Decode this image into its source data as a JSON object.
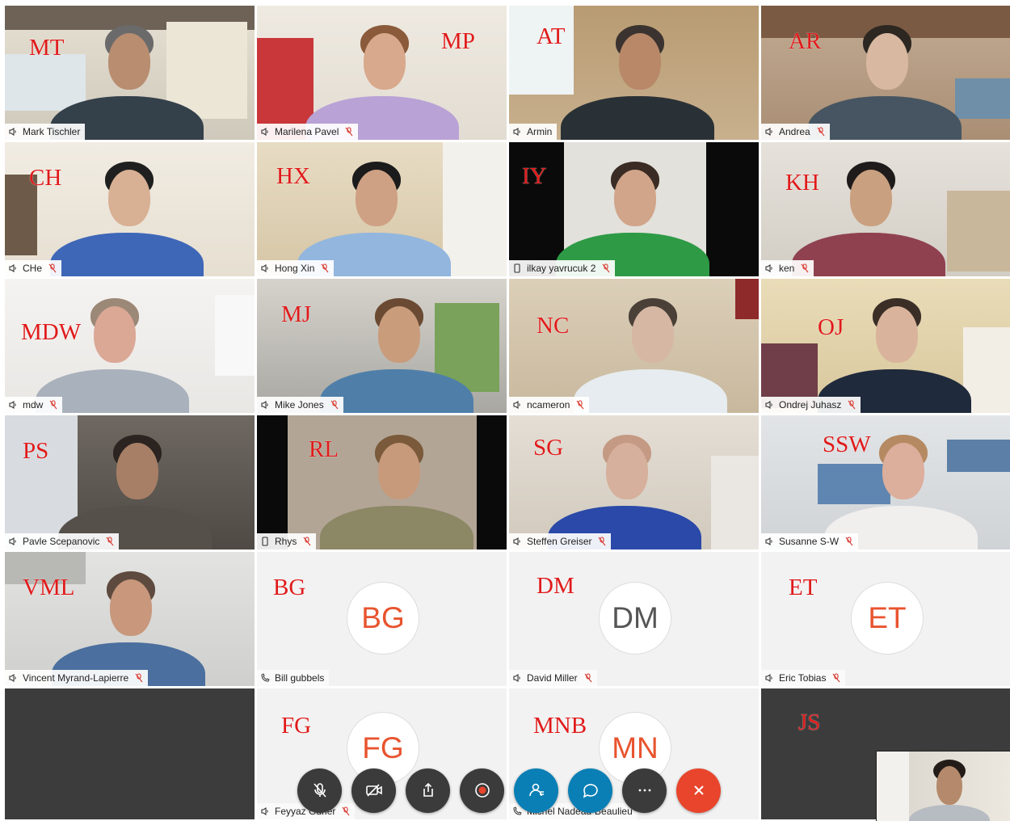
{
  "participants": [
    {
      "initials": "MT",
      "name": "Mark Tischler",
      "icon": "speaker-icon",
      "muted": false,
      "active": true
    },
    {
      "initials": "MP",
      "name": "Marilena Pavel",
      "icon": "speaker-icon",
      "muted": true,
      "active": false
    },
    {
      "initials": "AT",
      "name": "Armin",
      "icon": "speaker-icon",
      "muted": false,
      "active": true
    },
    {
      "initials": "AR",
      "name": "Andrea",
      "icon": "speaker-icon",
      "muted": true,
      "active": false
    },
    {
      "initials": "CH",
      "name": "CHe",
      "icon": "speaker-icon",
      "muted": true,
      "active": false
    },
    {
      "initials": "HX",
      "name": "Hong Xin",
      "icon": "speaker-icon",
      "muted": true,
      "active": false
    },
    {
      "initials": "IY",
      "name": "ilkay yavrucuk 2",
      "icon": "phone-device-icon",
      "muted": true,
      "active": false
    },
    {
      "initials": "KH",
      "name": "ken",
      "icon": "speaker-icon",
      "muted": true,
      "active": false
    },
    {
      "initials": "MDW",
      "name": "mdw",
      "icon": "speaker-icon",
      "muted": true,
      "active": false
    },
    {
      "initials": "MJ",
      "name": "Mike Jones",
      "icon": "speaker-icon",
      "muted": true,
      "active": false
    },
    {
      "initials": "NC",
      "name": "ncameron",
      "icon": "speaker-icon",
      "muted": true,
      "active": false
    },
    {
      "initials": "OJ",
      "name": "Ondrej Juhasz",
      "icon": "speaker-icon",
      "muted": true,
      "active": false
    },
    {
      "initials": "PS",
      "name": "Pavle Scepanovic",
      "icon": "speaker-icon",
      "muted": true,
      "active": false
    },
    {
      "initials": "RL",
      "name": "Rhys",
      "icon": "phone-device-icon",
      "muted": true,
      "active": false
    },
    {
      "initials": "SG",
      "name": "Steffen Greiser",
      "icon": "speaker-icon",
      "muted": true,
      "active": false
    },
    {
      "initials": "SSW",
      "name": "Susanne S-W",
      "icon": "speaker-icon",
      "muted": true,
      "active": false
    },
    {
      "initials": "VML",
      "name": "Vincent Myrand-Lapierre",
      "icon": "speaker-icon",
      "muted": true,
      "active": false
    },
    {
      "initials": "BG",
      "name": "Bill gubbels",
      "icon": "telephone-icon",
      "muted": false,
      "active": false,
      "avatar": "BG",
      "avatar_color": "#e8542f"
    },
    {
      "initials": "DM",
      "name": "David Miller",
      "icon": "speaker-icon",
      "muted": true,
      "active": false,
      "avatar": "DM",
      "avatar_color": "#555555"
    },
    {
      "initials": "ET",
      "name": "Eric Tobias",
      "icon": "speaker-icon",
      "muted": true,
      "active": false,
      "avatar": "ET",
      "avatar_color": "#e8542f"
    },
    {
      "initials": "",
      "name": "",
      "icon": "",
      "muted": false,
      "active": false
    },
    {
      "initials": "FG",
      "name": "Feyyaz Guner",
      "icon": "speaker-icon",
      "muted": true,
      "active": false,
      "avatar": "FG",
      "avatar_color": "#e8542f"
    },
    {
      "initials": "MNB",
      "name": "Michel Nadeau-Beaulieu",
      "icon": "telephone-icon",
      "muted": false,
      "active": false,
      "avatar": "MN",
      "avatar_color": "#e8542f"
    },
    {
      "initials": "JS",
      "name": "",
      "icon": "",
      "muted": false,
      "active": false
    }
  ],
  "toolbar": {
    "buttons": [
      {
        "name": "mute-button",
        "icon": "microphone-off-icon",
        "color": "#3b3b3b"
      },
      {
        "name": "stop-video-button",
        "icon": "camera-off-icon",
        "color": "#3b3b3b"
      },
      {
        "name": "share-button",
        "icon": "share-icon",
        "color": "#3b3b3b"
      },
      {
        "name": "record-button",
        "icon": "record-icon",
        "color": "#3b3b3b"
      },
      {
        "name": "participants-button",
        "icon": "participants-icon",
        "color": "#0a7fb5"
      },
      {
        "name": "chat-button",
        "icon": "chat-icon",
        "color": "#0a7fb5"
      },
      {
        "name": "more-button",
        "icon": "more-icon",
        "color": "#3b3b3b"
      },
      {
        "name": "leave-button",
        "icon": "close-icon",
        "color": "#e8452c"
      }
    ]
  },
  "colors": {
    "active_outline": "#2fb9d6",
    "initials_overlay": "#e01a1a",
    "mute_indicator": "#d9342b"
  }
}
